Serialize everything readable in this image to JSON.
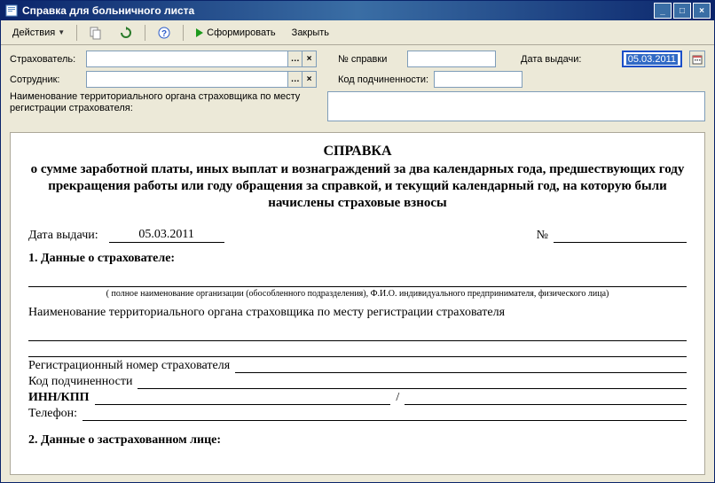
{
  "window": {
    "title": "Справка для больничного листа"
  },
  "toolbar": {
    "actions": "Действия",
    "generate": "Сформировать",
    "close": "Закрыть"
  },
  "form": {
    "insurer_label": "Страхователь:",
    "insurer_value": "",
    "employee_label": "Сотрудник:",
    "employee_value": "",
    "cert_number_label": "№ справки",
    "cert_number_value": "",
    "issue_date_label": "Дата выдачи:",
    "issue_date_value": "05.03.2011",
    "subord_code_label": "Код подчиненности:",
    "subord_code_value": "",
    "territorial_label_l1": "Наименование территориального органа страховщика по месту",
    "territorial_label_l2": "регистрации страхователя:",
    "territorial_value": ""
  },
  "doc": {
    "title_main": "СПРАВКА",
    "title_sub": "о сумме заработной платы, иных выплат и вознаграждений за два календарных года, предшествующих году прекращения работы или году обращения за справкой, и текущий календарный год, на которую были начислены страховые взносы",
    "issue_date_label": "Дата выдачи:",
    "issue_date_value": "05.03.2011",
    "number_label": "№",
    "number_value": "",
    "section1": "1. Данные о страхователе:",
    "hint1": "( полное наименование организации (обособленного подразделения), Ф.И.О.  индивидуального предпринимателя, физического лица)",
    "territorial_text": "Наименование территориального органа страховщика по месту регистрации страхователя",
    "reg_number_label": "Регистрационный номер страхователя",
    "subord_code_label": "Код подчиненности",
    "inn_kpp_label": "ИНН/КПП",
    "inn_kpp_sep": "/",
    "phone_label": "Телефон:",
    "section2": "2. Данные о застрахованном лице:"
  }
}
